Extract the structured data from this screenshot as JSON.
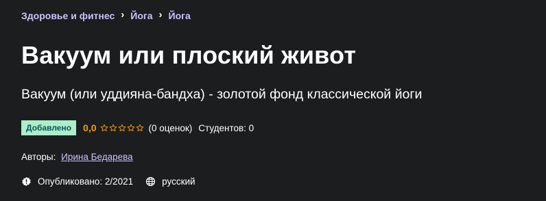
{
  "breadcrumb": {
    "items": [
      "Здоровье и фитнес",
      "Йога",
      "Йога"
    ],
    "separator": "›"
  },
  "course": {
    "title": "Вакуум или плоский живот",
    "subtitle": "Вакуум (или уддияна-бандха) - золотой фонд классической йоги"
  },
  "rating_row": {
    "badge": "Добавлено",
    "rating": "0,0",
    "stars_filled": 0,
    "stars_total": 5,
    "rating_count": "(0 оценок)",
    "students": "Студентов: 0"
  },
  "authors": {
    "label": "Авторы:",
    "name": "Ирина Бедарева"
  },
  "meta": {
    "published": "Опубликовано: 2/2021",
    "language": "русский"
  },
  "colors": {
    "background": "#1c1d1f",
    "link": "#cec0fc",
    "badge_bg": "#aceec7",
    "badge_text": "#0d5261",
    "rating": "#f69c08"
  },
  "icons": {
    "star": "star-outline-icon",
    "published": "alert-badge-icon",
    "language": "globe-icon"
  }
}
